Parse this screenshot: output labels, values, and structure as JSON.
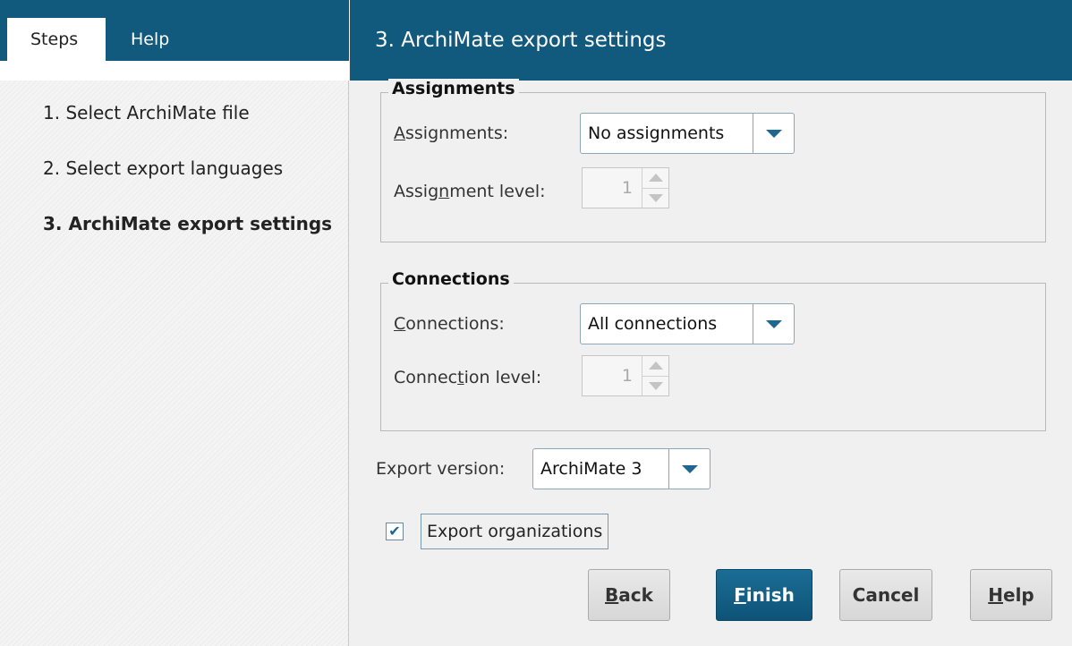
{
  "tabs": {
    "steps": "Steps",
    "help": "Help"
  },
  "steps": [
    {
      "label": "1. Select ArchiMate file"
    },
    {
      "label": "2. Select export languages"
    },
    {
      "label": "3. ArchiMate export settings"
    }
  ],
  "header": {
    "title": "3. ArchiMate export settings"
  },
  "assignments_group": {
    "legend": "Assignments",
    "combo_label_u": "A",
    "combo_label_rest": "ssignments:",
    "combo_value": "No assignments",
    "level_label_pre": "Assig",
    "level_label_u": "n",
    "level_label_post": "ment level:",
    "level_value": "1"
  },
  "connections_group": {
    "legend": "Connections",
    "combo_label_u": "C",
    "combo_label_rest": "onnections:",
    "combo_value": "All connections",
    "level_label_pre": "Connec",
    "level_label_u": "t",
    "level_label_post": "ion level:",
    "level_value": "1"
  },
  "export_version": {
    "label": "Export version:",
    "value": "ArchiMate 3"
  },
  "export_organizations": {
    "label": "Export organizations",
    "checked": true,
    "check_glyph": "✔"
  },
  "buttons": {
    "back_u": "B",
    "back_rest": "ack",
    "finish_u": "F",
    "finish_rest": "inish",
    "cancel": "Cancel",
    "help_u": "H",
    "help_rest": "elp"
  },
  "colors": {
    "accent": "#115a7e",
    "primary_button": "#0e5377"
  }
}
